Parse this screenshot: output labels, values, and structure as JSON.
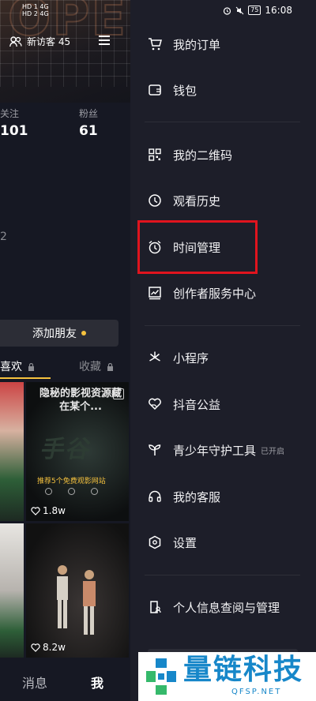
{
  "status_bar": {
    "left_lines": [
      "HD 1 4G",
      "HD 2 4G"
    ],
    "time": "16:08",
    "battery": "75"
  },
  "profile": {
    "visitor_label": "新访客 45",
    "following_label": "关注",
    "following_count": "101",
    "followers_label": "粉丝",
    "followers_count": "61",
    "dash_glyph": "2",
    "add_friend_label": "添加朋友",
    "tabs": {
      "likes": "喜欢",
      "favorites": "收藏"
    },
    "video_cards": [
      {
        "headline": "隐秘的影视资源藏在某个...",
        "big_text": "手谷",
        "subtitle": "推荐5个免费观影网站",
        "likes": "1.8w"
      },
      {
        "likes": "8.2w"
      }
    ],
    "bottom_nav": {
      "messages": "消息",
      "me": "我"
    }
  },
  "drawer": {
    "items": [
      {
        "icon": "cart-icon",
        "label": "我的订单"
      },
      {
        "icon": "wallet-icon",
        "label": "钱包"
      },
      {
        "icon": "qrcode-icon",
        "label": "我的二维码"
      },
      {
        "icon": "clock-icon",
        "label": "观看历史"
      },
      {
        "icon": "alarm-clock-icon",
        "label": "时间管理"
      },
      {
        "icon": "chart-icon",
        "label": "创作者服务中心"
      },
      {
        "icon": "asterisk-icon",
        "label": "小程序"
      },
      {
        "icon": "heart-hand-icon",
        "label": "抖音公益"
      },
      {
        "icon": "sprout-icon",
        "label": "青少年守护工具",
        "note": "已开启"
      },
      {
        "icon": "headset-icon",
        "label": "我的客服"
      },
      {
        "icon": "hexagon-settings-icon",
        "label": "设置"
      },
      {
        "icon": "person-doc-icon",
        "label": "个人信息查阅与管理"
      }
    ],
    "highlight_color": "#e0141e"
  },
  "watermark": {
    "title": "量链科技",
    "url": "QFSP.NET",
    "color": "#1787c9"
  }
}
